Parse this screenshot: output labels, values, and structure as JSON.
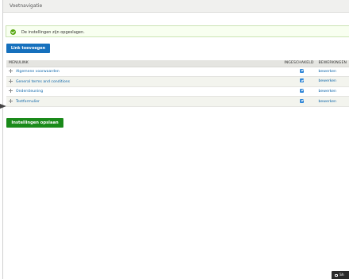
{
  "header": {
    "title": "Voetnavigatie"
  },
  "status": {
    "message": "De instellingen zijn opgeslagen."
  },
  "add_link_label": "Link toevoegen",
  "table": {
    "columns": [
      "MENULINK",
      "INGESCHAKELD",
      "BEWERKINGEN"
    ],
    "rows": [
      {
        "label": "Algemene voorwaarden",
        "enabled": true,
        "op": "bewerken"
      },
      {
        "label": "General terms and conditions",
        "enabled": true,
        "op": "bewerken"
      },
      {
        "label": "Ondersteuning",
        "enabled": true,
        "op": "bewerken"
      },
      {
        "label": "Testformulier",
        "enabled": true,
        "op": "bewerken"
      }
    ]
  },
  "save_label": "Instellingen opslaan",
  "chat": {
    "label": "Sh"
  },
  "colors": {
    "primary": "#1570bd",
    "save": "#1a8a1a",
    "success": "#56a70f"
  }
}
